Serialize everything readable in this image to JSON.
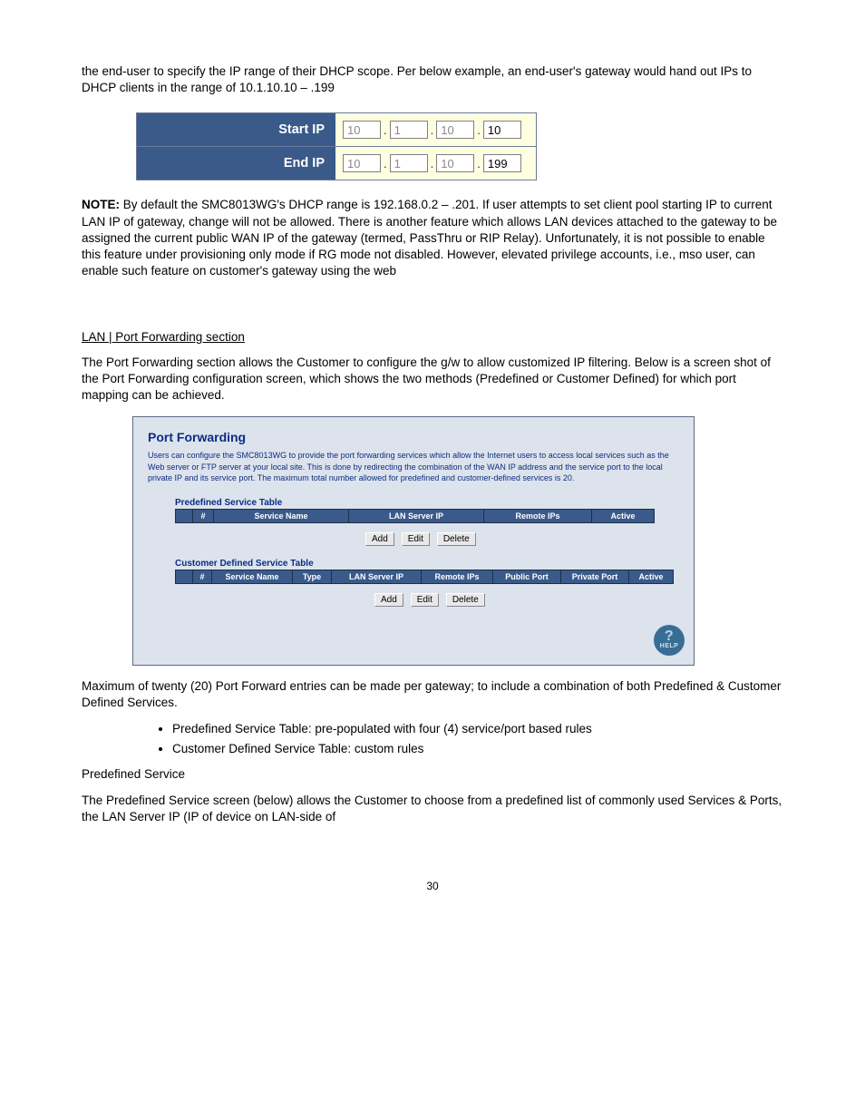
{
  "para_intro": "the end-user to specify the IP range of their DHCP scope. Per below example, an end-user's gateway would hand out IPs to DHCP clients in the range of 10.1.10.10 – .199",
  "ip_panel": {
    "start_label": "Start IP",
    "end_label": "End IP",
    "start": {
      "o1": "10",
      "o2": "1",
      "o3": "10",
      "o4": "10"
    },
    "end": {
      "o1": "10",
      "o2": "1",
      "o3": "10",
      "o4": "199"
    }
  },
  "note_head": "NOTE:",
  "note_body": " By default the SMC8013WG's DHCP range is 192.168.0.2 – .201. If user attempts to set client pool starting IP to current LAN IP of gateway, change will not be allowed. There is another feature which allows LAN devices attached to the gateway to be assigned the current public WAN IP of the gateway (termed, PassThru or RIP Relay). Unfortunately, it is not possible to enable this feature under provisioning only mode if RG mode not disabled. However, elevated privilege accounts, i.e., mso user, can enable such feature on customer's gateway using the web",
  "lan_section": "LAN | Port Forwarding section",
  "pf_intro": "The Port Forwarding section allows the Customer to configure the g/w to allow customized IP filtering. Below is a screen shot of the Port Forwarding configuration screen, which shows the two methods (Predefined or Customer Defined) for which port mapping can be achieved.",
  "pf_box": {
    "title": "Port Forwarding",
    "desc": "Users can configure the SMC8013WG to provide the port forwarding services which allow the Internet users to access local services such as the Web server or FTP server at your local site. This is done by redirecting the combination of the WAN IP address and the service port to the local private IP and its service port. The maximum total number allowed for predefined and customer-defined services is 20.",
    "predef_caption": "Predefined Service Table",
    "predef_cols": [
      "",
      "#",
      "Service Name",
      "LAN Server IP",
      "Remote IPs",
      "Active"
    ],
    "cust_caption": "Customer Defined Service Table",
    "cust_cols": [
      "",
      "#",
      "Service Name",
      "Type",
      "LAN Server IP",
      "Remote IPs",
      "Public Port",
      "Private Port",
      "Active"
    ],
    "buttons": {
      "add": "Add",
      "edit": "Edit",
      "del": "Delete"
    },
    "help": "HELP"
  },
  "twenty_note": "Maximum of twenty (20) Port Forward entries can be made per gateway; to include a combination of both Predefined & Customer Defined Services.",
  "bullets": [
    "Predefined Service Table: pre-populated with four (4) service/port based rules",
    "Customer Defined Service Table: custom rules"
  ],
  "predef_intro": "Predefined Service",
  "predef_body": "The Predefined Service screen (below) allows the Customer to choose from a predefined list of commonly used Services & Ports, the LAN Server IP (IP of device on LAN-side of",
  "page_num": "30"
}
